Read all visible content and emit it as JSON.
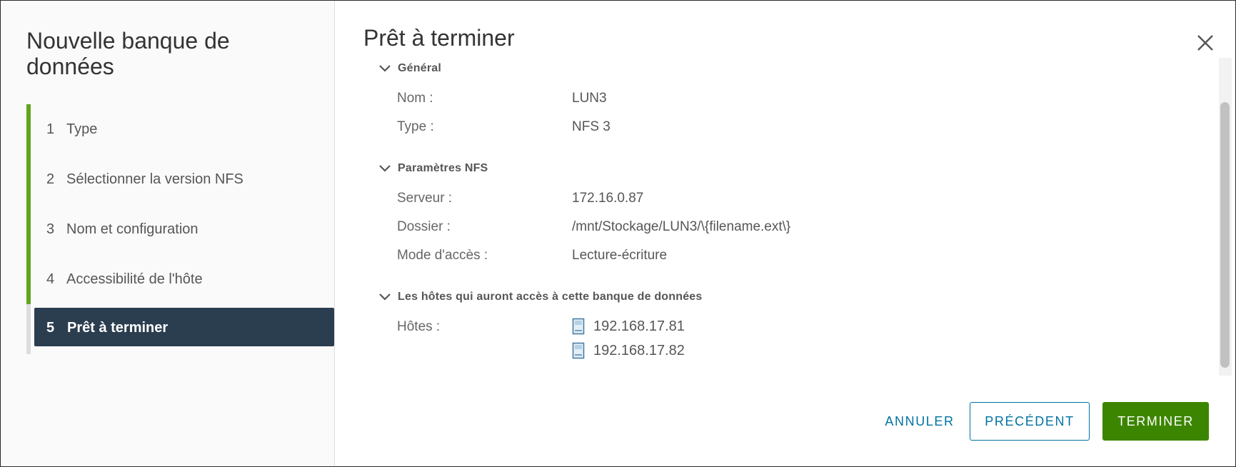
{
  "wizard": {
    "title": "Nouvelle banque de données",
    "steps": [
      {
        "num": "1",
        "label": "Type"
      },
      {
        "num": "2",
        "label": "Sélectionner la version NFS"
      },
      {
        "num": "3",
        "label": "Nom et configuration"
      },
      {
        "num": "4",
        "label": "Accessibilité de l'hôte"
      },
      {
        "num": "5",
        "label": "Prêt à terminer"
      }
    ],
    "active_step": 5
  },
  "page": {
    "title": "Prêt à terminer"
  },
  "sections": {
    "general": {
      "heading": "Général",
      "name_label": "Nom :",
      "name_value": "LUN3",
      "type_label": "Type :",
      "type_value": "NFS 3"
    },
    "nfs": {
      "heading": "Paramètres NFS",
      "server_label": "Serveur :",
      "server_value": "172.16.0.87",
      "folder_label": "Dossier :",
      "folder_value": "/mnt/Stockage/LUN3/\\{filename.ext\\}",
      "access_label": "Mode d'accès :",
      "access_value": "Lecture-écriture"
    },
    "hosts": {
      "heading": "Les hôtes qui auront accès à cette banque de données",
      "hosts_label": "Hôtes :",
      "list": [
        "192.168.17.81",
        "192.168.17.82"
      ]
    }
  },
  "buttons": {
    "cancel": "ANNULER",
    "previous": "PRÉCÉDENT",
    "finish": "TERMINER"
  },
  "colors": {
    "accent_green": "#62a420",
    "active_step_bg": "#2b3e50",
    "link_blue": "#0072a3",
    "finish_green": "#3c8500"
  },
  "icons": {
    "close": "close-icon",
    "chevron": "chevron-down-icon",
    "host": "host-server-icon"
  }
}
